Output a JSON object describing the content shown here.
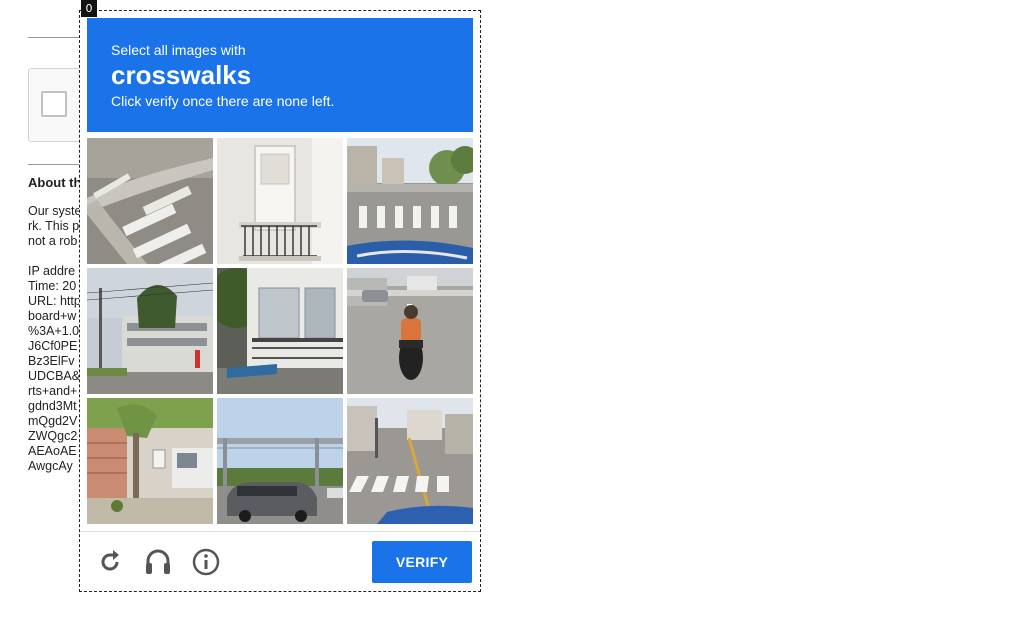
{
  "badge": "0",
  "prompt": {
    "line1": "Select all images with",
    "keyword": "crosswalks",
    "line3": "Click verify once there are none left."
  },
  "background": {
    "about_title": "About th",
    "lines": [
      "Our syste",
      "rk. This p",
      "not a rob",
      "",
      "IP addre",
      "Time: 20",
      "URL: http",
      "board+w",
      "%3A+1.0",
      "J6Cf0PE",
      "Bz3ElFv",
      "UDCBA&",
      "rts+and+",
      "gdnd3Mt",
      "mQgd2V",
      "ZWQgc2",
      "AEAoAE",
      "AwgcAy"
    ]
  },
  "tiles": [
    {
      "scene": "curb-crosswalk"
    },
    {
      "scene": "balcony-door"
    },
    {
      "scene": "street-crosswalk"
    },
    {
      "scene": "building-pole"
    },
    {
      "scene": "apartment-balcony"
    },
    {
      "scene": "motorcycle-rider"
    },
    {
      "scene": "sidewalk-tree-van"
    },
    {
      "scene": "overhead-sign-car"
    },
    {
      "scene": "road-crosswalk-houses"
    }
  ],
  "footer": {
    "reload_icon": "reload-icon",
    "audio_icon": "headphones-icon",
    "info_icon": "info-icon",
    "verify_label": "VERIFY"
  },
  "colors": {
    "accent": "#1a73e8"
  }
}
